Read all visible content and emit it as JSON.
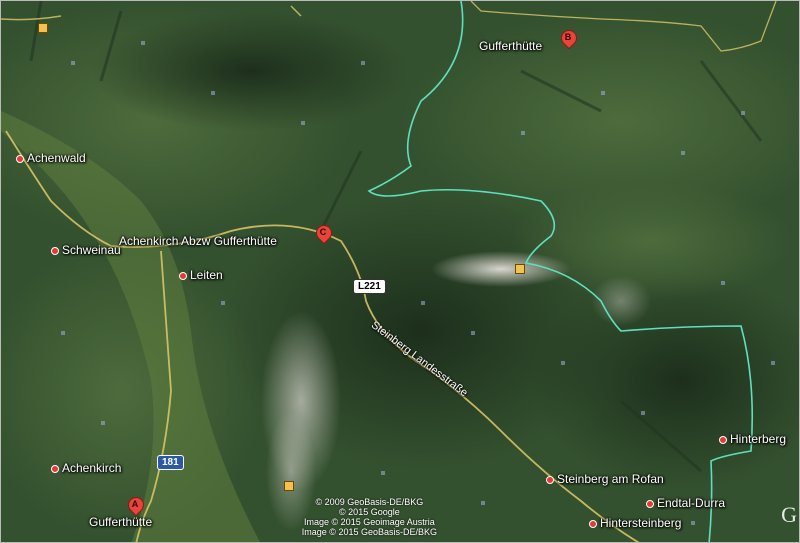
{
  "map": {
    "places": [
      {
        "id": "achenwald",
        "label": "Achenwald"
      },
      {
        "id": "schweinau",
        "label": "Schweinau"
      },
      {
        "id": "leiten",
        "label": "Leiten"
      },
      {
        "id": "achenkirch",
        "label": "Achenkirch"
      },
      {
        "id": "gufferthuette-a",
        "label": "Gufferthütte"
      },
      {
        "id": "gufferthuette-b",
        "label": "Gufferthütte"
      },
      {
        "id": "achenkirch-abzw",
        "label": "Achenkirch Abzw Gufferthütte"
      },
      {
        "id": "steinberg",
        "label": "Steinberg am Rofan"
      },
      {
        "id": "hintersteinberg",
        "label": "Hintersteinberg"
      },
      {
        "id": "endtal",
        "label": "Endtal-Durra"
      },
      {
        "id": "hinterberg",
        "label": "Hinterberg"
      }
    ],
    "markers": {
      "a": "A",
      "b": "B",
      "c": "C"
    },
    "road_shields": {
      "l221": "L221",
      "r181": "181"
    },
    "road_name": "Steinberg Landesstraße",
    "attribution": {
      "line1": "© 2009 GeoBasis-DE/BKG",
      "line2": "© 2015 Google",
      "line3": "Image © 2015 Geoimage Austria",
      "line4": "Image © 2015 GeoBasis-DE/BKG"
    },
    "logo": "G",
    "colors": {
      "terrain": "#2f4a2c",
      "border": "#5ee0c0",
      "road": "#e0c96a",
      "marker": "#e5453a"
    }
  }
}
